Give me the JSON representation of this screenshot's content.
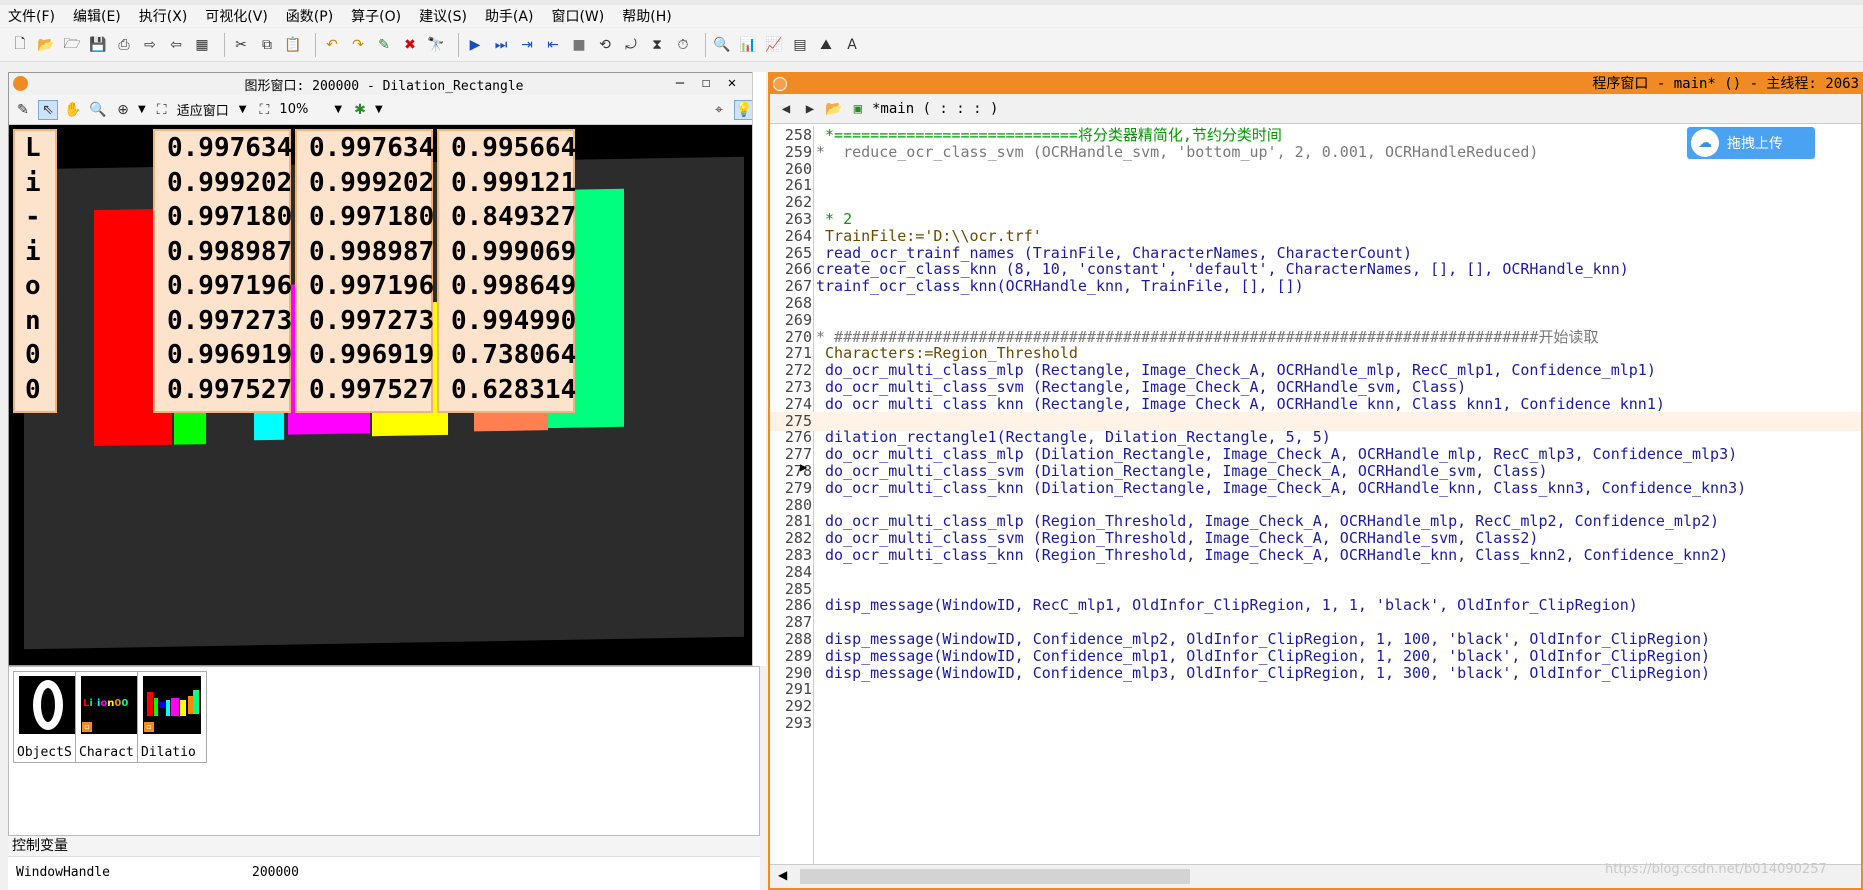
{
  "menu": [
    "文件(F)",
    "编辑(E)",
    "执行(X)",
    "可视化(V)",
    "函数(P)",
    "算子(O)",
    "建议(S)",
    "助手(A)",
    "窗口(W)",
    "帮助(H)"
  ],
  "graphics_window": {
    "title": "图形窗口: 200000 - Dilation_Rectangle",
    "zoom_mode": "适应窗口",
    "zoom_percent": "10%",
    "label_col": [
      "L",
      "i",
      "-",
      "i",
      "o",
      "n",
      "0",
      "0"
    ],
    "confidences": [
      [
        "0.997634",
        "0.999202",
        "0.997180",
        "0.998987",
        "0.997196",
        "0.997273",
        "0.996919",
        "0.997527"
      ],
      [
        "0.997634",
        "0.999202",
        "0.997180",
        "0.998987",
        "0.997196",
        "0.997273",
        "0.996919",
        "0.997527"
      ],
      [
        "0.995664",
        "0.999121",
        "0.849327",
        "0.999069",
        "0.998649",
        "0.994990",
        "0.738064",
        "0.628314"
      ]
    ],
    "block_colors": [
      "#ff0000",
      "#00ff00",
      "#0000ff",
      "#00ffff",
      "#ff00ff",
      "#ffff00",
      "#ff7f50",
      "#00ff7f"
    ]
  },
  "variables": {
    "iconic": [
      {
        "name": "ObjectS"
      },
      {
        "name": "Charact"
      },
      {
        "name": "Dilatio"
      }
    ],
    "control_header": "控制变量",
    "control": [
      {
        "name": "WindowHandle",
        "value": "200000"
      }
    ]
  },
  "program_window": {
    "title": "程序窗口 - main* () - 主线程: 2063",
    "procedure": "*main ( : : : )",
    "lines": [
      {
        "no": "258",
        "text": " *===========================将分类器精简化,节约分类时间",
        "cls": "cmt"
      },
      {
        "no": "259",
        "text": "*  reduce_ocr_class_svm (OCRHandle_svm, 'bottom_up', 2, 0.001, OCRHandleReduced)",
        "cls": "cmtg"
      },
      {
        "no": "260",
        "text": "",
        "cls": ""
      },
      {
        "no": "261",
        "text": "",
        "cls": ""
      },
      {
        "no": "262",
        "text": "",
        "cls": ""
      },
      {
        "no": "263",
        "text": " * 2",
        "cls": "cmt"
      },
      {
        "no": "264",
        "text": " TrainFile:='D:\\\\ocr.trf'",
        "cls": "asg"
      },
      {
        "no": "265",
        "text": " read_ocr_trainf_names (TrainFile, CharacterNames, CharacterCount)",
        "cls": "op"
      },
      {
        "no": "266",
        "text": "create_ocr_class_knn (8, 10, 'constant', 'default', CharacterNames, [], [], OCRHandle_knn)",
        "cls": "op"
      },
      {
        "no": "267",
        "text": "trainf_ocr_class_knn(OCRHandle_knn, TrainFile, [], [])",
        "cls": "op"
      },
      {
        "no": "268",
        "text": "",
        "cls": ""
      },
      {
        "no": "269",
        "text": "",
        "cls": ""
      },
      {
        "no": "270",
        "text": "* ##############################################################################开始读取",
        "cls": "cmtg"
      },
      {
        "no": "271",
        "text": " Characters:=Region_Threshold",
        "cls": "asg"
      },
      {
        "no": "272",
        "text": " do_ocr_multi_class_mlp (Rectangle, Image_Check_A, OCRHandle_mlp, RecC_mlp1, Confidence_mlp1)",
        "cls": "op"
      },
      {
        "no": "273",
        "text": " do_ocr_multi_class_svm (Rectangle, Image_Check_A, OCRHandle_svm, Class)",
        "cls": "op"
      },
      {
        "no": "274",
        "text": " do_ocr_multi_class_knn (Rectangle, Image_Check_A, OCRHandle_knn, Class_knn1, Confidence_knn1)",
        "cls": "op"
      },
      {
        "no": "275",
        "text": "",
        "cls": "cur"
      },
      {
        "no": "276",
        "text": " dilation_rectangle1(Rectangle, Dilation_Rectangle, 5, 5)",
        "cls": "op"
      },
      {
        "no": "277",
        "text": " do_ocr_multi_class_mlp (Dilation_Rectangle, Image_Check_A, OCRHandle_mlp, RecC_mlp3, Confidence_mlp3)",
        "cls": "op"
      },
      {
        "no": "278",
        "text": " do_ocr_multi_class_svm (Dilation_Rectangle, Image_Check_A, OCRHandle_svm, Class)",
        "cls": "op"
      },
      {
        "no": "279",
        "text": " do_ocr_multi_class_knn (Dilation_Rectangle, Image_Check_A, OCRHandle_knn, Class_knn3, Confidence_knn3)",
        "cls": "op"
      },
      {
        "no": "280",
        "text": "",
        "cls": ""
      },
      {
        "no": "281",
        "text": " do_ocr_multi_class_mlp (Region_Threshold, Image_Check_A, OCRHandle_mlp, RecC_mlp2, Confidence_mlp2)",
        "cls": "op"
      },
      {
        "no": "282",
        "text": " do_ocr_multi_class_svm (Region_Threshold, Image_Check_A, OCRHandle_svm, Class2)",
        "cls": "op"
      },
      {
        "no": "283",
        "text": " do_ocr_multi_class_knn (Region_Threshold, Image_Check_A, OCRHandle_knn, Class_knn2, Confidence_knn2)",
        "cls": "op"
      },
      {
        "no": "284",
        "text": "",
        "cls": ""
      },
      {
        "no": "285",
        "text": "",
        "cls": ""
      },
      {
        "no": "286",
        "text": " disp_message(WindowID, RecC_mlp1, OldInfor_ClipRegion, 1, 1, 'black', OldInfor_ClipRegion)",
        "cls": "op"
      },
      {
        "no": "287",
        "text": "",
        "cls": ""
      },
      {
        "no": "288",
        "text": " disp_message(WindowID, Confidence_mlp2, OldInfor_ClipRegion, 1, 100, 'black', OldInfor_ClipRegion)",
        "cls": "op"
      },
      {
        "no": "289",
        "text": " disp_message(WindowID, Confidence_mlp1, OldInfor_ClipRegion, 1, 200, 'black', OldInfor_ClipRegion)",
        "cls": "op"
      },
      {
        "no": "290",
        "text": " disp_message(WindowID, Confidence_mlp3, OldInfor_ClipRegion, 1, 300, 'black', OldInfor_ClipRegion)",
        "cls": "op"
      },
      {
        "no": "291",
        "text": "",
        "cls": ""
      },
      {
        "no": "292",
        "text": "",
        "cls": ""
      },
      {
        "no": "293",
        "text": "",
        "cls": ""
      }
    ]
  },
  "upload_button": "拖拽上传",
  "watermark": "https://blog.csdn.net/b014090257"
}
